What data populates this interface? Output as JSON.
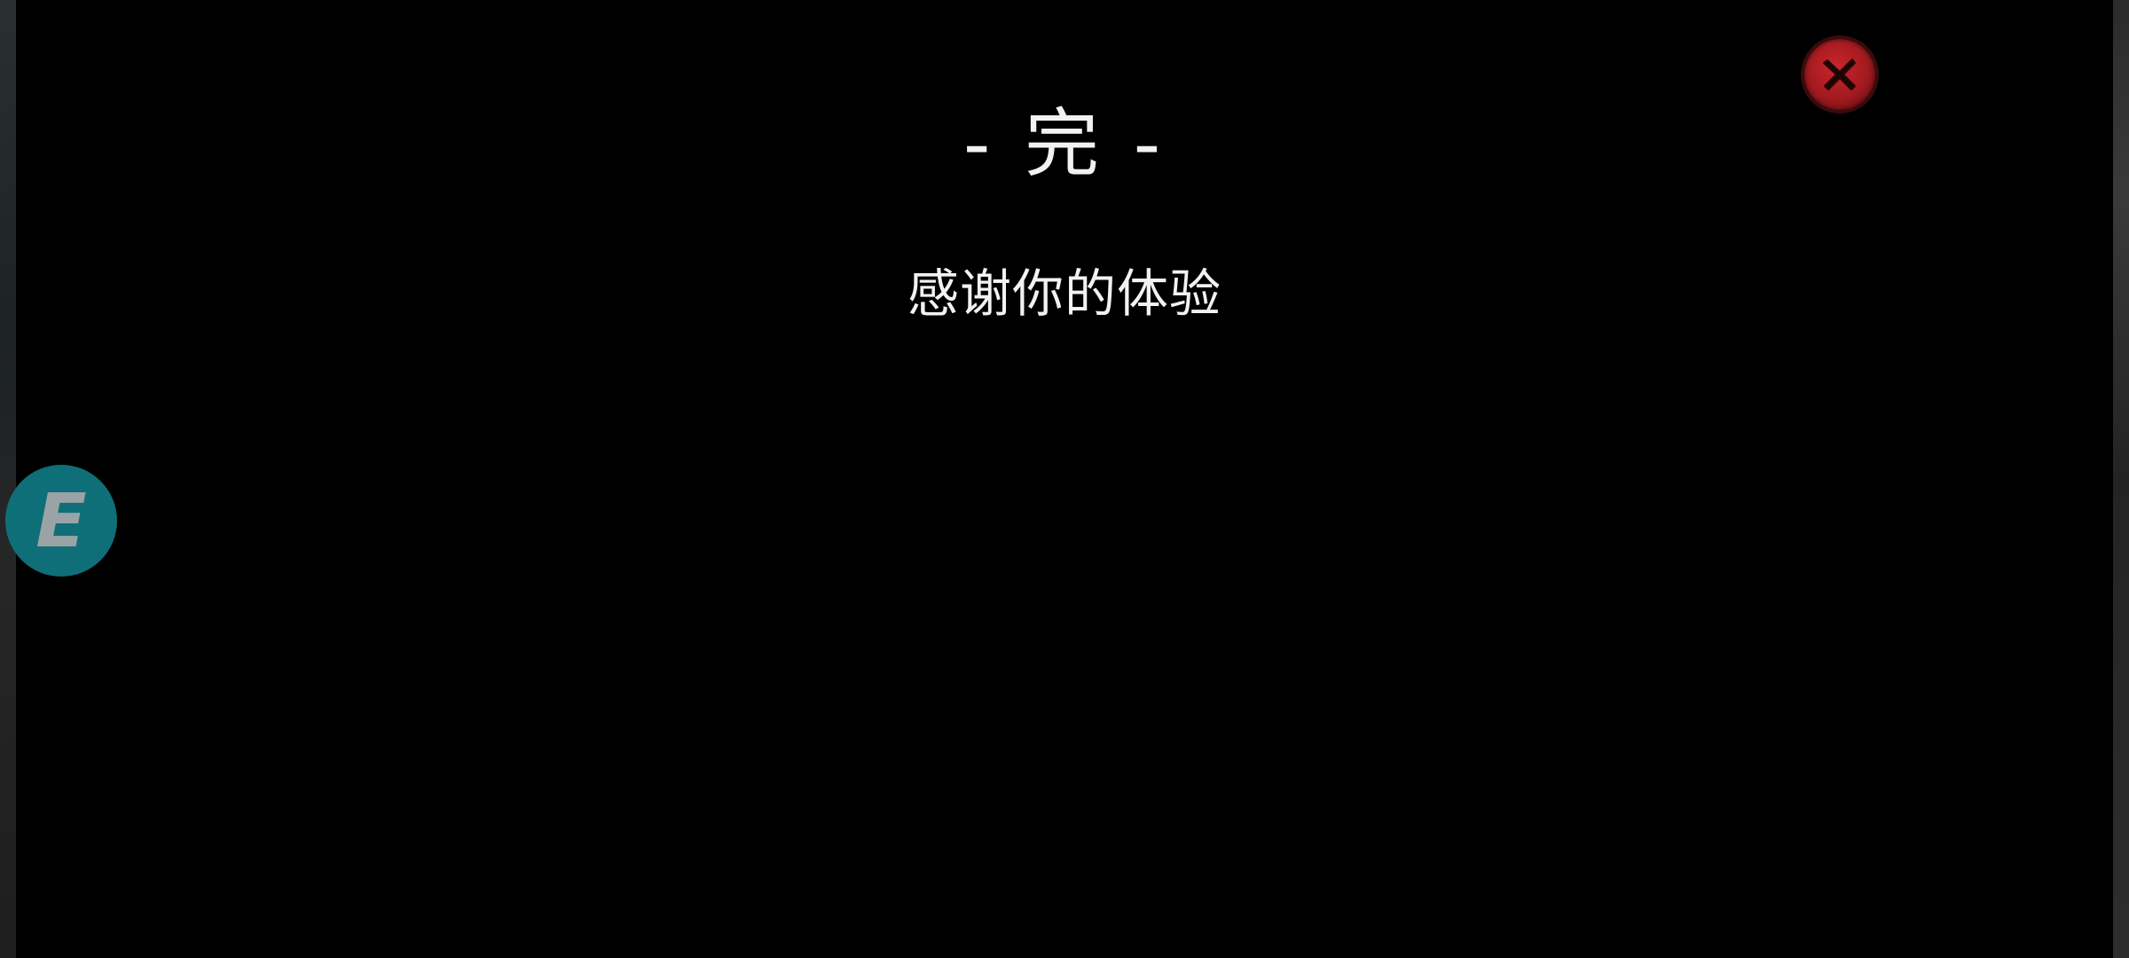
{
  "ending": {
    "title": "- 完 -",
    "message": "感谢你的体验"
  },
  "controls": {
    "close_icon": "close-x-icon",
    "interact_key_label": "E"
  },
  "colors": {
    "overlay": "#000000",
    "text": "#f2f2f2",
    "close_button": "#b51e23",
    "interact_button": "#0f6f78"
  }
}
